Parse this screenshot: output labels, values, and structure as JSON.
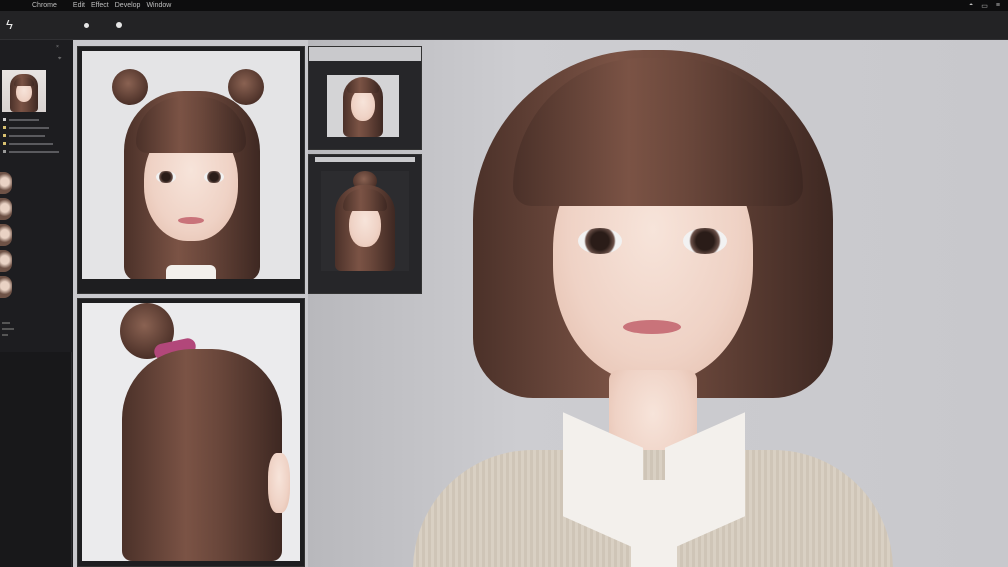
{
  "menubar": {
    "apple_glyph": "",
    "menus": [
      "Chrome",
      "Edit",
      "Effect",
      "Develop",
      "Window"
    ],
    "status_icons": [
      "wifi-icon",
      "display-icon",
      "menu-icon"
    ]
  },
  "toolbar": {
    "tool_icon": "lightning-icon"
  },
  "sidebar": {
    "title": "",
    "close_glyph": "×",
    "pin_glyph": "⌖"
  },
  "canvas": {
    "panels": [
      {
        "name": "front-bun-portrait"
      },
      {
        "name": "small-preview-top"
      },
      {
        "name": "small-preview-bottom"
      },
      {
        "name": "back-view-portrait"
      },
      {
        "name": "main-bob-portrait"
      }
    ]
  },
  "colors": {
    "background": "#1c1c1e",
    "canvas": "#c9c9cd",
    "accent_ribbon": "#b2477a"
  }
}
